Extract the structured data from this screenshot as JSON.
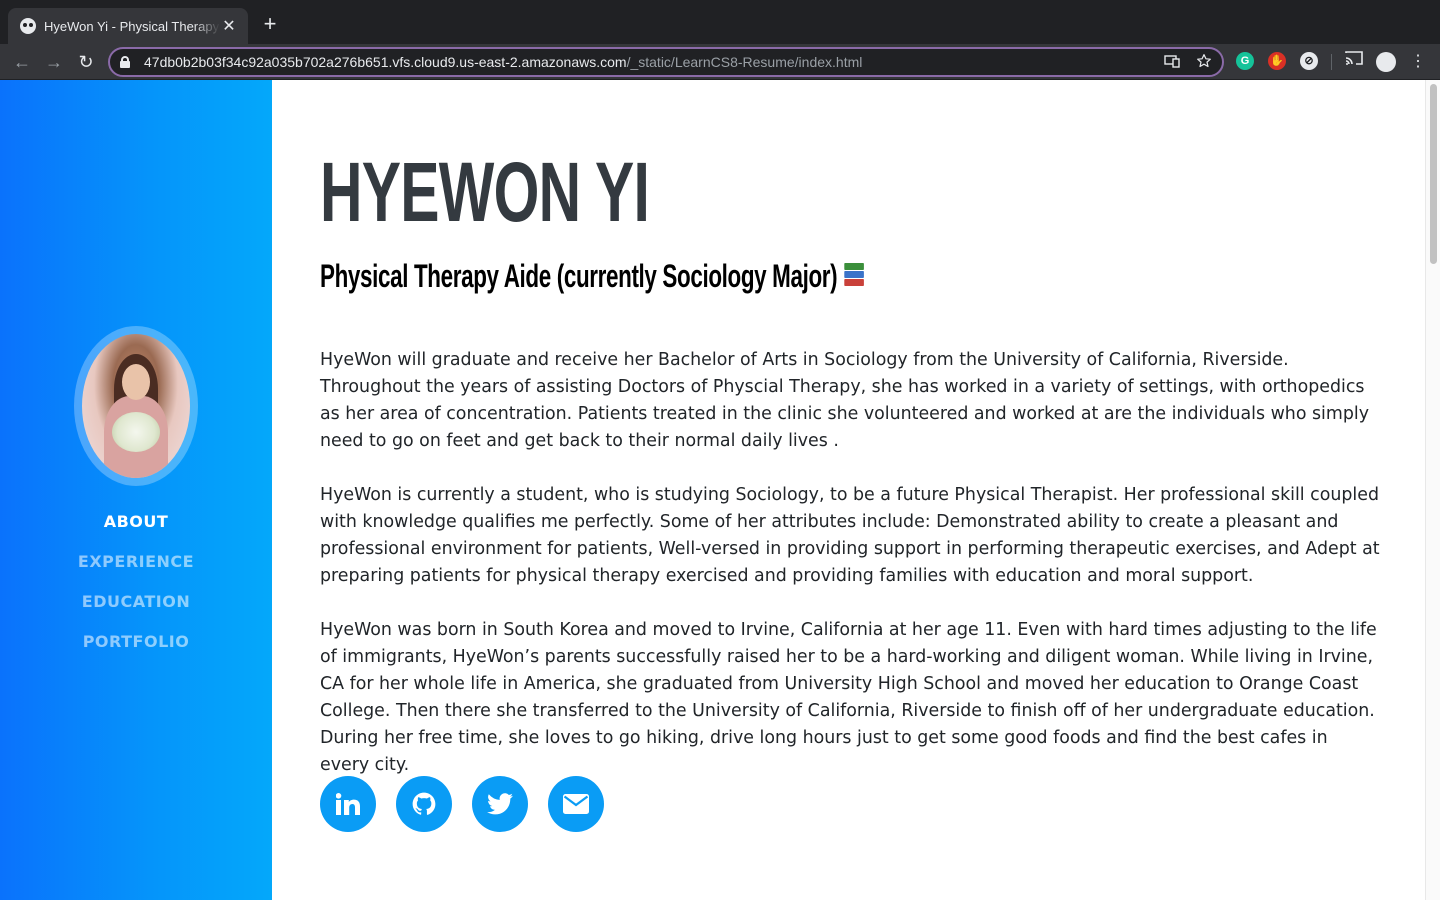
{
  "browser": {
    "tab_title": "HyeWon Yi - Physical Therapy Aide",
    "tab_close": "✕",
    "new_tab": "+",
    "url_host": "47db0b2b03f34c92a035b702a276b651.vfs.cloud9.us-east-2.amazonaws.com",
    "url_path": "/_static/LearnCS8-Resume/index.html",
    "back": "←",
    "forward": "→",
    "reload": "↻",
    "menu": "⋮"
  },
  "sidebar": {
    "nav": [
      {
        "label": "ABOUT",
        "active": true
      },
      {
        "label": "EXPERIENCE",
        "active": false
      },
      {
        "label": "EDUCATION",
        "active": false
      },
      {
        "label": "PORTFOLIO",
        "active": false
      }
    ]
  },
  "main": {
    "name": "HYEWON YI",
    "subtitle": "Physical Therapy Aide (currently Sociology Major)",
    "paragraphs": [
      "HyeWon will graduate and receive her Bachelor of Arts in Sociology from the University of California, Riverside. Throughout the years of assisting Doctors of Physcial Therapy, she has worked in a variety of settings, with orthopedics as her area of concentration. Patients treated in the clinic she volunteered and worked at are the individuals who simply need to go on feet and get back to their normal daily lives .",
      "HyeWon is currently a student, who is studying Sociology, to be a future Physical Therapist. Her professional skill coupled with knowledge qualifies me perfectly. Some of her attributes include: Demonstrated ability to create a pleasant and professional environment for patients, Well-versed in providing support in performing therapeutic exercises, and Adept at preparing patients for physical therapy exercised and providing families with education and moral support.",
      "HyeWon was born in South Korea and moved to Irvine, California at her age 11. Even with hard times adjusting to the life of immigrants, HyeWon’s parents successfully raised her to be a hard-working and diligent woman. While living in Irvine, CA for her whole life in America, she graduated from University High School and moved her education to Orange Coast College. Then there she transferred to the University of California, Riverside to finish off of her undergraduate education. During her free time, she loves to go hiking, drive long hours just to get some good foods and find the best cafes in every city."
    ],
    "socials": [
      {
        "icon": "linkedin-icon"
      },
      {
        "icon": "github-icon"
      },
      {
        "icon": "twitter-icon"
      },
      {
        "icon": "envelope-icon"
      }
    ]
  },
  "colors": {
    "sidebar_start": "#0a72fc",
    "sidebar_end": "#04a8fa",
    "social_bg": "#0a9cf5",
    "heading": "#343a40"
  }
}
